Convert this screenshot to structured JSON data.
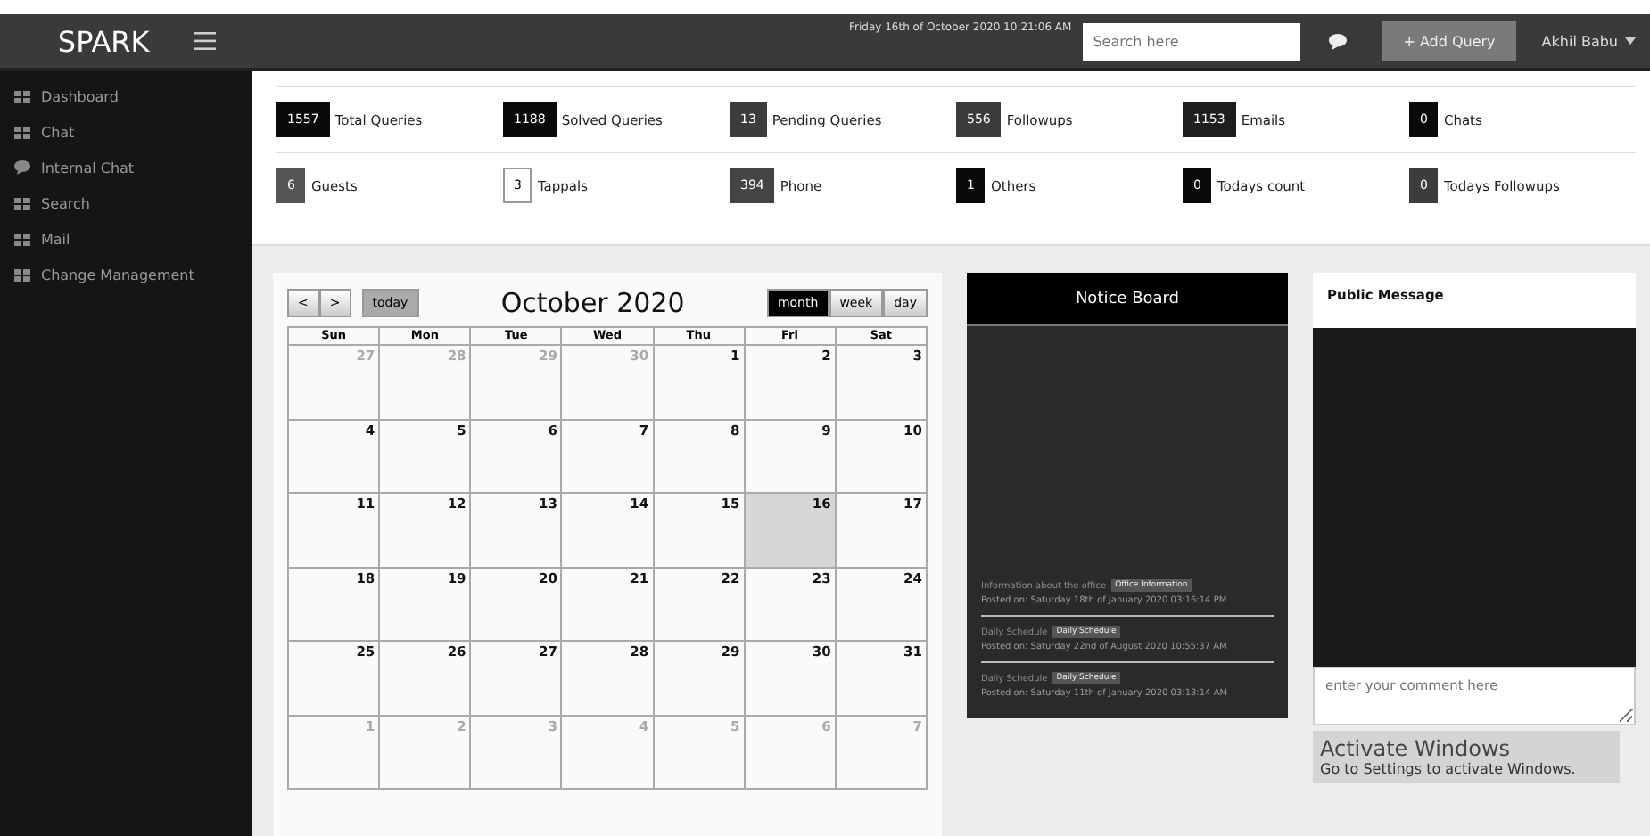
{
  "topbar": {
    "logo": "SPARK",
    "datetime": "Friday 16th of October 2020 10:21:06 AM",
    "search": {
      "placeholder": "Search here"
    },
    "add_button": "+ Add Query",
    "user": "Akhil Babu"
  },
  "sidebar": {
    "items": [
      {
        "label": "Dashboard",
        "kind": "grid"
      },
      {
        "label": "Chat",
        "kind": "grid"
      },
      {
        "label": "Internal Chat",
        "kind": "chat"
      },
      {
        "label": "Search",
        "kind": "grid"
      },
      {
        "label": "Mail",
        "kind": "grid"
      },
      {
        "label": "Change Management",
        "kind": "grid"
      }
    ]
  },
  "stats": [
    [
      {
        "count": "1557",
        "label": "Total Queries",
        "color": "#0a0a0a"
      },
      {
        "count": "1188",
        "label": "Solved Queries",
        "color": "#0a0a0a"
      },
      {
        "count": "13",
        "label": "Pending Queries",
        "color": "#3c3c3c"
      },
      {
        "count": "556",
        "label": "Followups",
        "color": "#3c3c3c"
      },
      {
        "count": "1153",
        "label": "Emails",
        "color": "#1e1e1e"
      },
      {
        "count": "0",
        "label": "Chats",
        "color": "#0a0a0a"
      }
    ],
    [
      {
        "count": "6",
        "label": "Guests",
        "color": "#555555"
      },
      {
        "count": "3",
        "label": "Tappals",
        "color": "#ffffff"
      },
      {
        "count": "394",
        "label": "Phone",
        "color": "#444444"
      },
      {
        "count": "1",
        "label": "Others",
        "color": "#0a0a0a"
      },
      {
        "count": "0",
        "label": "Todays count",
        "color": "#0a0a0a"
      },
      {
        "count": "0",
        "label": "Todays Followups",
        "color": "#3c3c3c"
      }
    ]
  ],
  "calendar": {
    "title": "October 2020",
    "prev": "<",
    "next": ">",
    "today": "today",
    "views": [
      {
        "label": "month",
        "selected": true
      },
      {
        "label": "week",
        "selected": false
      },
      {
        "label": "day",
        "selected": false
      }
    ],
    "weekdays": [
      "Sun",
      "Mon",
      "Tue",
      "Wed",
      "Thu",
      "Fri",
      "Sat"
    ],
    "weeks": [
      [
        {
          "day": "27",
          "other": true,
          "today": false
        },
        {
          "day": "28",
          "other": true,
          "today": false
        },
        {
          "day": "29",
          "other": true,
          "today": false
        },
        {
          "day": "30",
          "other": true,
          "today": false
        },
        {
          "day": "1",
          "other": false,
          "today": false
        },
        {
          "day": "2",
          "other": false,
          "today": false
        },
        {
          "day": "3",
          "other": false,
          "today": false
        }
      ],
      [
        {
          "day": "4",
          "other": false,
          "today": false
        },
        {
          "day": "5",
          "other": false,
          "today": false
        },
        {
          "day": "6",
          "other": false,
          "today": false
        },
        {
          "day": "7",
          "other": false,
          "today": false
        },
        {
          "day": "8",
          "other": false,
          "today": false
        },
        {
          "day": "9",
          "other": false,
          "today": false
        },
        {
          "day": "10",
          "other": false,
          "today": false
        }
      ],
      [
        {
          "day": "11",
          "other": false,
          "today": false
        },
        {
          "day": "12",
          "other": false,
          "today": false
        },
        {
          "day": "13",
          "other": false,
          "today": false
        },
        {
          "day": "14",
          "other": false,
          "today": false
        },
        {
          "day": "15",
          "other": false,
          "today": false
        },
        {
          "day": "16",
          "other": false,
          "today": true
        },
        {
          "day": "17",
          "other": false,
          "today": false
        }
      ],
      [
        {
          "day": "18",
          "other": false,
          "today": false
        },
        {
          "day": "19",
          "other": false,
          "today": false
        },
        {
          "day": "20",
          "other": false,
          "today": false
        },
        {
          "day": "21",
          "other": false,
          "today": false
        },
        {
          "day": "22",
          "other": false,
          "today": false
        },
        {
          "day": "23",
          "other": false,
          "today": false
        },
        {
          "day": "24",
          "other": false,
          "today": false
        }
      ],
      [
        {
          "day": "25",
          "other": false,
          "today": false
        },
        {
          "day": "26",
          "other": false,
          "today": false
        },
        {
          "day": "27",
          "other": false,
          "today": false
        },
        {
          "day": "28",
          "other": false,
          "today": false
        },
        {
          "day": "29",
          "other": false,
          "today": false
        },
        {
          "day": "30",
          "other": false,
          "today": false
        },
        {
          "day": "31",
          "other": false,
          "today": false
        }
      ],
      [
        {
          "day": "1",
          "other": true,
          "today": false
        },
        {
          "day": "2",
          "other": true,
          "today": false
        },
        {
          "day": "3",
          "other": true,
          "today": false
        },
        {
          "day": "4",
          "other": true,
          "today": false
        },
        {
          "day": "5",
          "other": true,
          "today": false
        },
        {
          "day": "6",
          "other": true,
          "today": false
        },
        {
          "day": "7",
          "other": true,
          "today": false
        }
      ]
    ]
  },
  "notice_board": {
    "title": "Notice Board",
    "items": [
      {
        "title": "Information about the office",
        "badge": "Office Information",
        "posted": "Posted on: Saturday 18th of January 2020 03:16:14 PM"
      },
      {
        "title": "Daily Schedule",
        "badge": "Daily Schedule",
        "posted": "Posted on: Saturday 22nd of August 2020 10:55:37 AM"
      },
      {
        "title": "Daily Schedule",
        "badge": "Daily Schedule",
        "posted": "Posted on: Saturday 11th of January 2020 03:13:14 AM"
      }
    ]
  },
  "public_message": {
    "title": "Public Message",
    "comment": {
      "placeholder": "enter your comment here"
    }
  },
  "activation_notice": {
    "title": "Activate Windows",
    "text": "Go to Settings to activate Windows."
  }
}
